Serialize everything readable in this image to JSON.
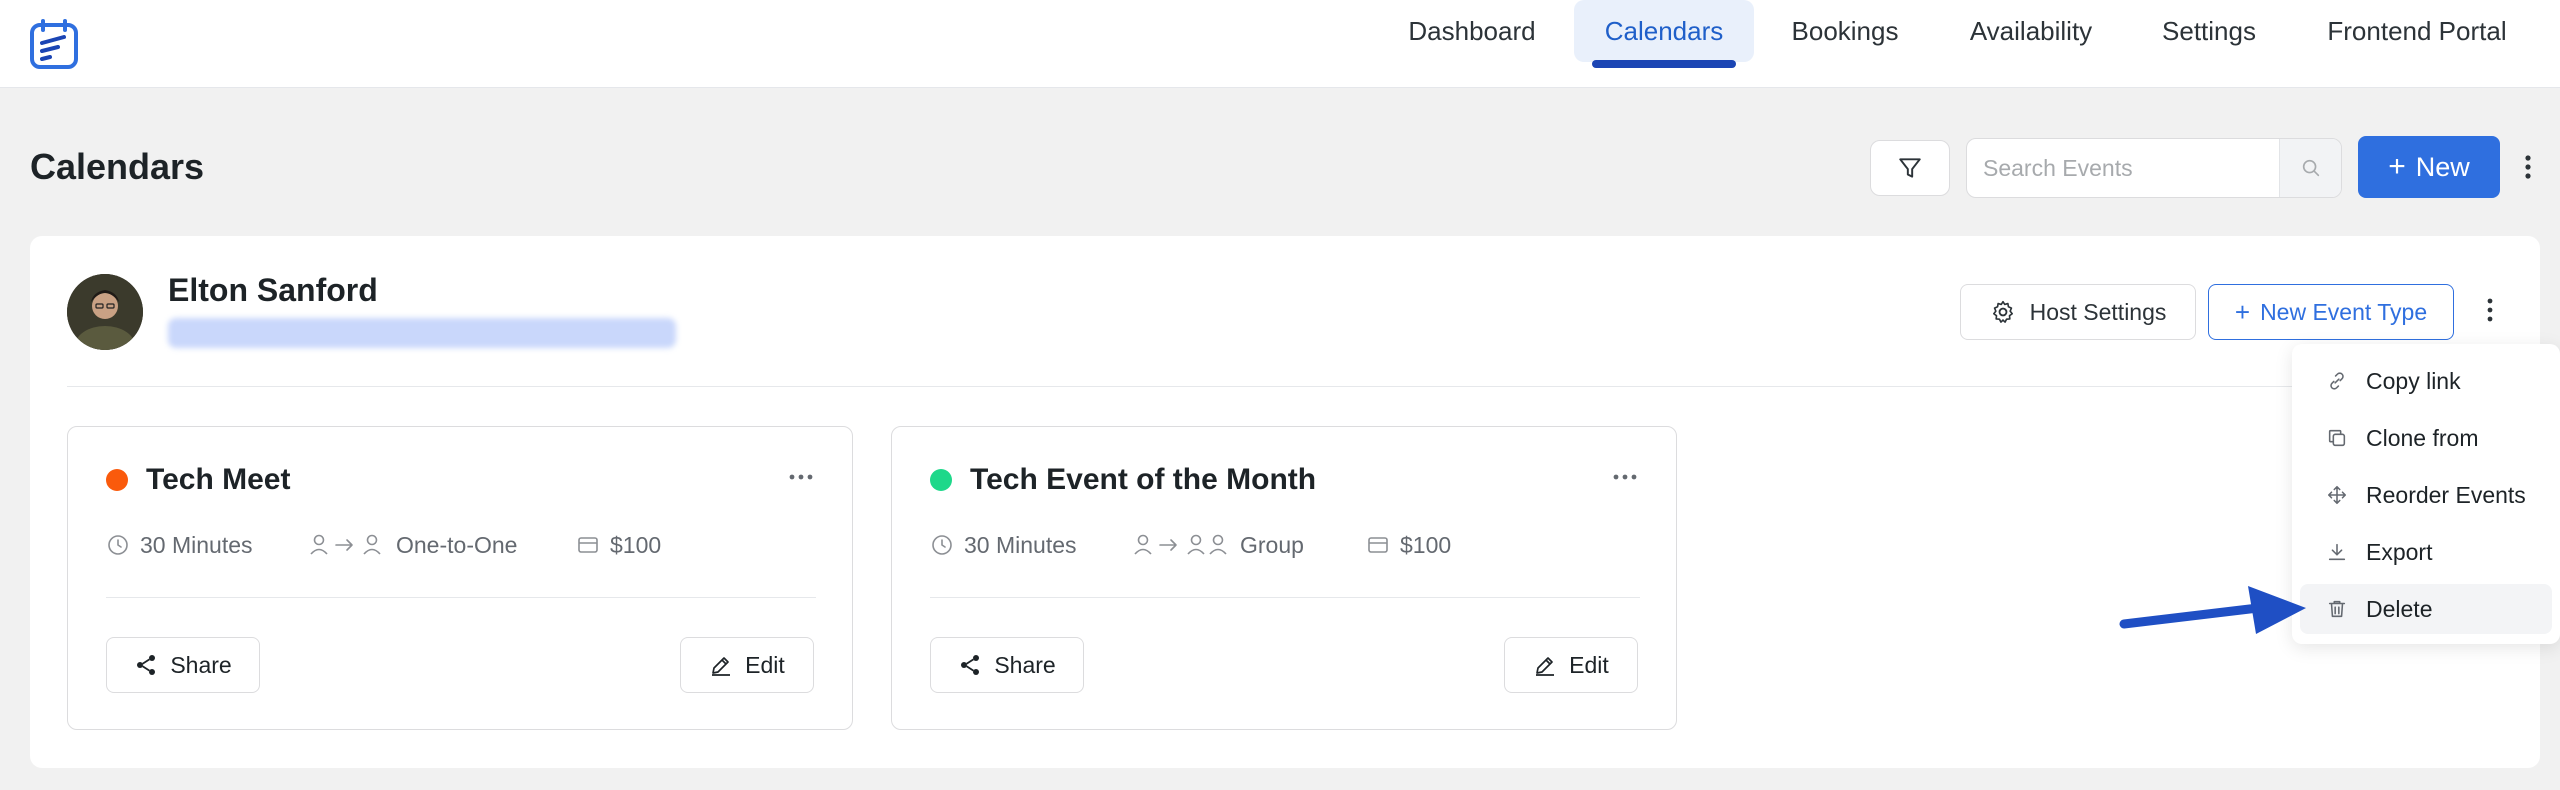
{
  "nav": {
    "items": [
      {
        "label": "Dashboard",
        "active": false
      },
      {
        "label": "Calendars",
        "active": true
      },
      {
        "label": "Bookings",
        "active": false
      },
      {
        "label": "Availability",
        "active": false
      },
      {
        "label": "Settings",
        "active": false
      },
      {
        "label": "Frontend Portal",
        "active": false
      }
    ]
  },
  "page": {
    "title": "Calendars",
    "search_placeholder": "Search Events",
    "new_button_label": "New"
  },
  "host": {
    "name": "Elton Sanford",
    "host_settings_label": "Host Settings",
    "new_event_type_label": "New Event Type"
  },
  "events": [
    {
      "title": "Tech Meet",
      "dot_color": "#fa5a0c",
      "duration": "30 Minutes",
      "type": "One-to-One",
      "price": "$100",
      "share_label": "Share",
      "edit_label": "Edit"
    },
    {
      "title": "Tech Event of the Month",
      "dot_color": "#1ed88a",
      "duration": "30 Minutes",
      "type": "Group",
      "price": "$100",
      "share_label": "Share",
      "edit_label": "Edit"
    }
  ],
  "dropdown": {
    "items": [
      {
        "label": "Copy link",
        "icon": "link-icon"
      },
      {
        "label": "Clone from",
        "icon": "clone-icon"
      },
      {
        "label": "Reorder Events",
        "icon": "move-icon"
      },
      {
        "label": "Export",
        "icon": "download-icon"
      },
      {
        "label": "Delete",
        "icon": "trash-icon"
      }
    ]
  },
  "colors": {
    "primary": "#2f6fdf",
    "nav_active_underline": "#1b45b4",
    "annotation_arrow": "#1f4fc4"
  }
}
